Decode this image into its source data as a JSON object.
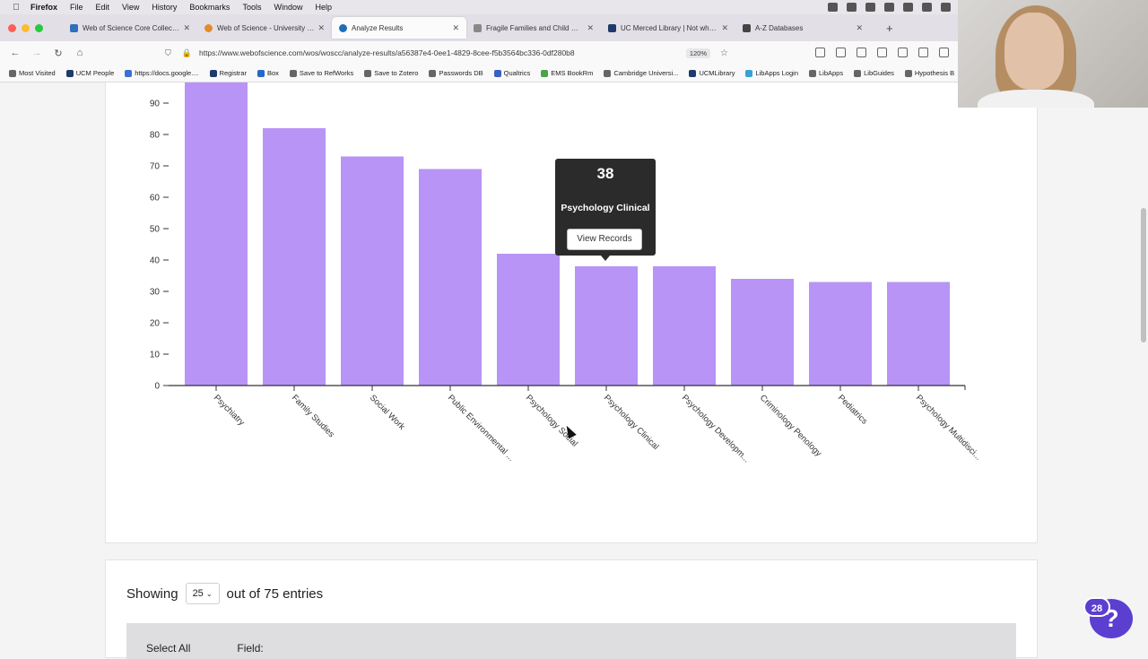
{
  "menubar": {
    "app": "Firefox",
    "items": [
      "File",
      "Edit",
      "View",
      "History",
      "Bookmarks",
      "Tools",
      "Window",
      "Help"
    ]
  },
  "tabs": [
    {
      "label": "Web of Science Core Collection",
      "color": "#2f6fbd"
    },
    {
      "label": "Web of Science - University of California",
      "color": "#e58a2b"
    },
    {
      "label": "Analyze Results",
      "color": "#1f6fb8",
      "active": true
    },
    {
      "label": "Fragile Families and Child Wellbeing",
      "color": "#888888"
    },
    {
      "label": "UC Merced Library | Not what or who",
      "color": "#1e3a6b"
    },
    {
      "label": "A-Z Databases",
      "color": "#444444"
    }
  ],
  "nav": {
    "url": "https://www.webofscience.com/wos/woscc/analyze-results/a56387e4-0ee1-4829-8cee-f5b3564bc336-0df280b8",
    "zoom": "120%"
  },
  "bookmarks": [
    {
      "label": "Most Visited",
      "color": "#666666"
    },
    {
      "label": "UCM People",
      "color": "#1e3a6b"
    },
    {
      "label": "https://docs.google....",
      "color": "#3b6fd6"
    },
    {
      "label": "Registrar",
      "color": "#1e3a6b"
    },
    {
      "label": "Box",
      "color": "#2468c9"
    },
    {
      "label": "Save to RefWorks",
      "color": "#666666"
    },
    {
      "label": "Save to Zotero",
      "color": "#666666"
    },
    {
      "label": "Passwords DB",
      "color": "#666666"
    },
    {
      "label": "Qualtrics",
      "color": "#3a5fc4"
    },
    {
      "label": "EMS BookRm",
      "color": "#4aa34a"
    },
    {
      "label": "Cambridge Universi...",
      "color": "#666666"
    },
    {
      "label": "UCMLibrary",
      "color": "#1e3a6b"
    },
    {
      "label": "LibApps Login",
      "color": "#3aa0d8"
    },
    {
      "label": "LibApps",
      "color": "#666666"
    },
    {
      "label": "LibGuides",
      "color": "#666666"
    },
    {
      "label": "Hypothesis B",
      "color": "#666666"
    }
  ],
  "chart_data": {
    "type": "bar",
    "categories": [
      "Psychiatry",
      "Family Studies",
      "Social Work",
      "Public Environmental ...",
      "Psychology Social",
      "Psychology Clinical",
      "Psychology Developm...",
      "Criminology Penology",
      "Pediatrics",
      "Psychology Multidisci..."
    ],
    "values": [
      97,
      82,
      73,
      69,
      42,
      38,
      38,
      34,
      33,
      33
    ],
    "yticks": [
      "0",
      "10",
      "20",
      "30",
      "40",
      "50",
      "60",
      "70",
      "80",
      "90"
    ],
    "ylim": [
      0,
      100
    ],
    "bar_color": "#b794f6"
  },
  "tooltip": {
    "value": "38",
    "category": "Psychology Clinical",
    "button": "View Records"
  },
  "table": {
    "showing_prefix": "Showing",
    "page_size": "25",
    "showing_suffix": "out of 75 entries",
    "select_all": "Select All",
    "field": "Field:"
  },
  "help": {
    "badge": "28",
    "icon": "?"
  }
}
